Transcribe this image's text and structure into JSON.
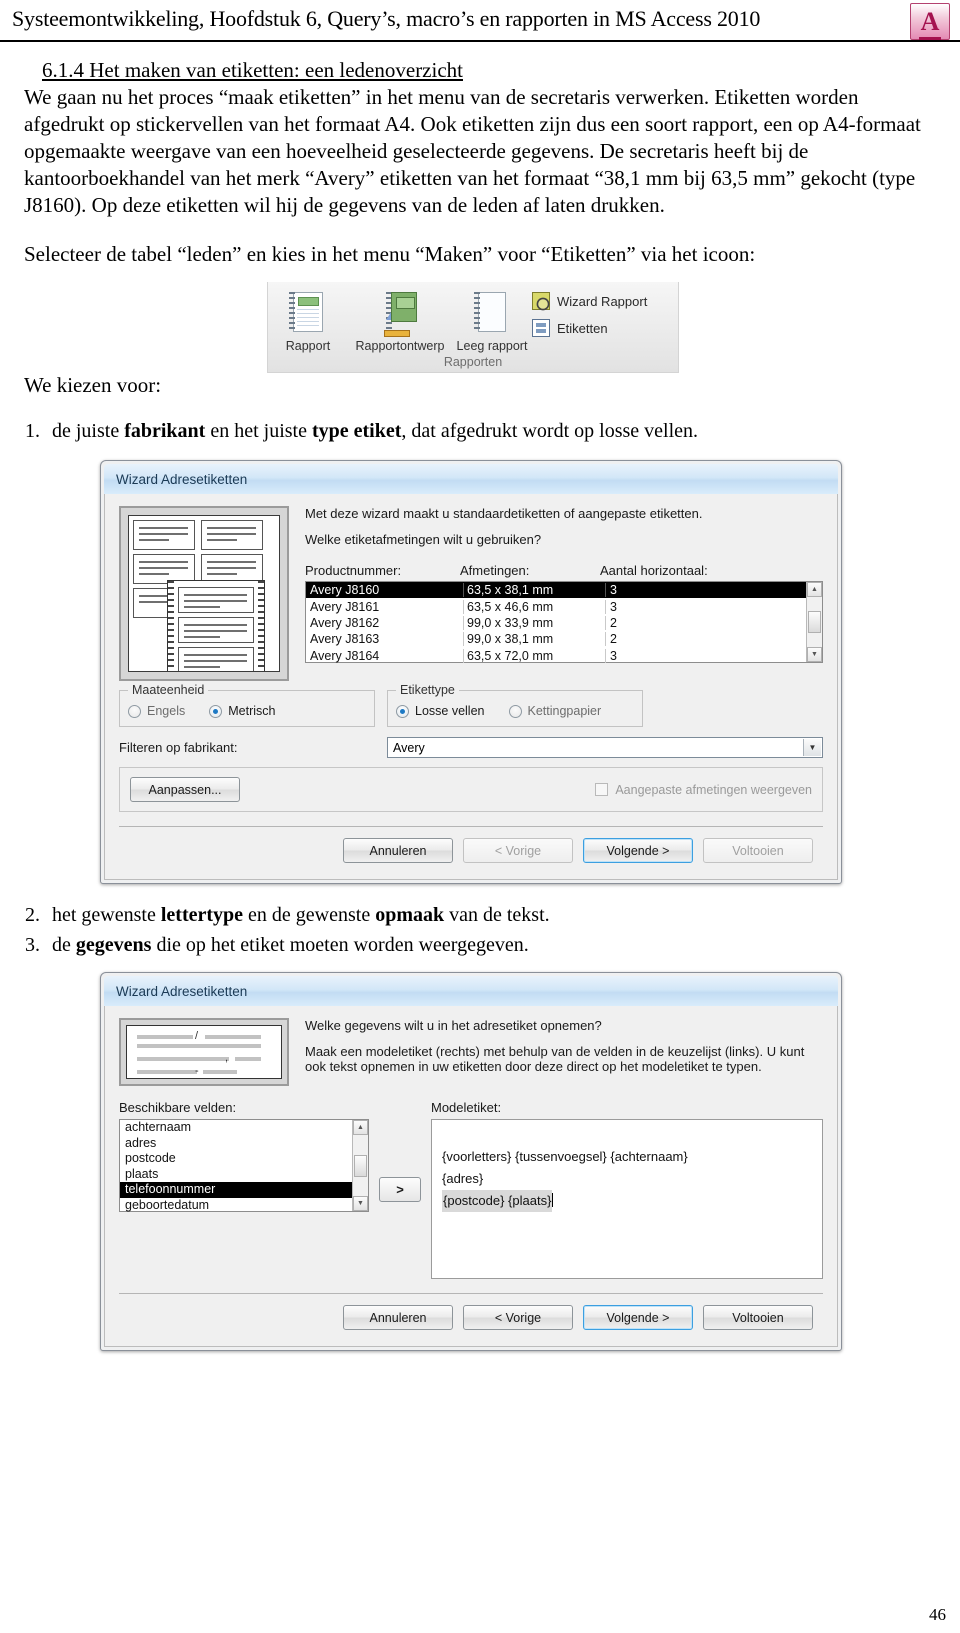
{
  "header": {
    "title": "Systeemontwikkeling, Hoofdstuk 6, Query’s, macro’s en rapporten in MS Access 2010",
    "logo_letter": "A"
  },
  "content": {
    "section_heading": "6.1.4 Het maken van etiketten: een ledenoverzicht",
    "paragraph_1": "We gaan nu het proces “maak etiketten” in het menu van de secretaris verwerken. Etiketten worden afgedrukt op stickervellen van het formaat A4. Ook  etiketten zijn dus een soort rapport, een op A4-formaat opgemaakte weergave van een hoeveelheid geselecteerde gegevens. De secretaris heeft bij de kantoorboekhandel van het merk “Avery” etiketten van het formaat “38,1 mm bij 63,5 mm” gekocht (type J8160). Op deze etiketten wil hij de gegevens van de leden af laten drukken.",
    "paragraph_2": "Selecteer de tabel “leden” en kies in het menu “Maken” voor “Etiketten” via het icoon:",
    "we_kiezen_voor": "We kiezen voor:",
    "list": [
      {
        "num": "1.",
        "parts": [
          {
            "t": "de juiste ",
            "b": false
          },
          {
            "t": "fabrikant",
            "b": true
          },
          {
            "t": " en het juiste ",
            "b": false
          },
          {
            "t": "type etiket",
            "b": true
          },
          {
            "t": ", dat afgedrukt wordt op losse vellen.",
            "b": false
          }
        ]
      },
      {
        "num": "2.",
        "parts": [
          {
            "t": "het gewenste ",
            "b": false
          },
          {
            "t": "lettertype",
            "b": true
          },
          {
            "t": " en de gewenste ",
            "b": false
          },
          {
            "t": "opmaak",
            "b": true
          },
          {
            "t": " van de tekst.",
            "b": false
          }
        ]
      },
      {
        "num": "3.",
        "parts": [
          {
            "t": "de ",
            "b": false
          },
          {
            "t": "gegevens",
            "b": true
          },
          {
            "t": " die op het etiket moeten worden weergegeven.",
            "b": false
          }
        ]
      }
    ],
    "page_number": "46"
  },
  "ribbon": {
    "buttons": [
      {
        "label": "Rapport",
        "icon": "report-document-icon"
      },
      {
        "label": "Rapportontwerp",
        "icon": "report-design-icon"
      },
      {
        "label": "Leeg rapport",
        "icon": "blank-report-icon"
      }
    ],
    "side_items": [
      {
        "label": "Wizard Rapport",
        "icon": "report-wizard-icon"
      },
      {
        "label": "Etiketten",
        "icon": "labels-icon"
      }
    ],
    "group_name": "Rapporten"
  },
  "dialog1": {
    "title": "Wizard Adresetiketten",
    "question_1": "Met deze wizard maakt u standaardetiketten of aangepaste etiketten.",
    "question_2": "Welke etiketafmetingen wilt u gebruiken?",
    "columns": [
      "Productnummer:",
      "Afmetingen:",
      "Aantal horizontaal:"
    ],
    "rows": [
      {
        "product": "Avery J8160",
        "size": "63,5 x 38,1 mm",
        "across": "3",
        "selected": true
      },
      {
        "product": "Avery J8161",
        "size": "63,5 x 46,6 mm",
        "across": "3",
        "selected": false
      },
      {
        "product": "Avery J8162",
        "size": "99,0 x 33,9 mm",
        "across": "2",
        "selected": false
      },
      {
        "product": "Avery J8163",
        "size": "99,0 x 38,1 mm",
        "across": "2",
        "selected": false
      },
      {
        "product": "Avery J8164",
        "size": "63,5 x 72,0 mm",
        "across": "3",
        "selected": false
      }
    ],
    "unit_group": {
      "legend": "Maateenheid",
      "options": [
        {
          "label": "Engels",
          "selected": false
        },
        {
          "label": "Metrisch",
          "selected": true
        }
      ]
    },
    "type_group": {
      "legend": "Etikettype",
      "options": [
        {
          "label": "Losse vellen",
          "selected": true
        },
        {
          "label": "Kettingpapier",
          "selected": false
        }
      ]
    },
    "filter_label": "Filteren op fabrikant:",
    "filter_value": "Avery",
    "customize_button": "Aanpassen...",
    "custom_checkbox": "Aangepaste afmetingen weergeven",
    "custom_checkbox_checked": false,
    "buttons": [
      {
        "label": "Annuleren",
        "state": "normal"
      },
      {
        "label": "< Vorige",
        "state": "disabled"
      },
      {
        "label": "Volgende >",
        "state": "focused"
      },
      {
        "label": "Voltooien",
        "state": "disabled"
      }
    ]
  },
  "dialog2": {
    "title": "Wizard Adresetiketten",
    "question_1": "Welke gegevens wilt u in het adresetiket opnemen?",
    "question_2": "Maak een modeletiket (rechts) met behulp van de velden in de keuzelijst (links). U kunt ook tekst opnemen in uw etiketten door deze direct op het modeletiket te typen.",
    "available_label": "Beschikbare velden:",
    "model_label": "Modeletiket:",
    "available_fields": [
      {
        "name": "achternaam",
        "selected": false
      },
      {
        "name": "adres",
        "selected": false
      },
      {
        "name": "postcode",
        "selected": false
      },
      {
        "name": "plaats",
        "selected": false
      },
      {
        "name": "telefoonnummer",
        "selected": true
      },
      {
        "name": "geboortedatum",
        "selected": false
      }
    ],
    "move_button": ">",
    "model_lines": [
      {
        "text": "{voorletters} {tussenvoegsel} {achternaam}",
        "selected": false
      },
      {
        "text": "{adres}",
        "selected": false
      },
      {
        "text": "{postcode} {plaats}",
        "selected": true
      }
    ],
    "buttons": [
      {
        "label": "Annuleren",
        "state": "normal"
      },
      {
        "label": "< Vorige",
        "state": "normal"
      },
      {
        "label": "Volgende >",
        "state": "focused"
      },
      {
        "label": "Voltooien",
        "state": "normal"
      }
    ]
  }
}
